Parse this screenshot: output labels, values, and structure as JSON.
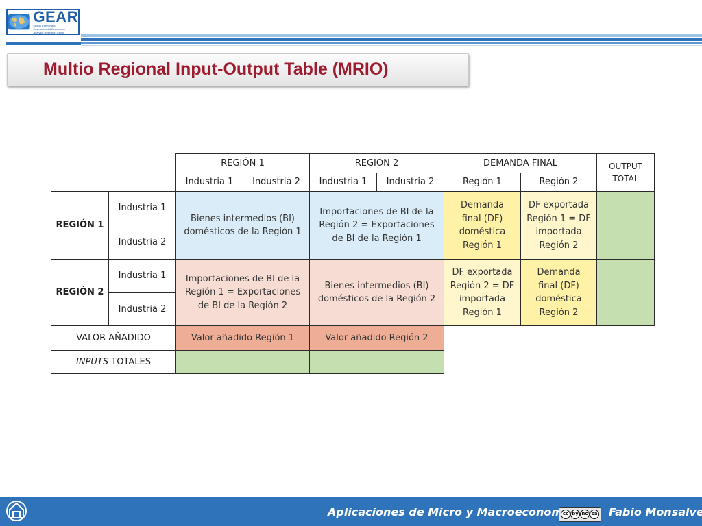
{
  "header": {
    "logo_word": "GEAR",
    "logo_tagline": "Global Energy and Environmental Economics Analysis Research Group",
    "title": "Multio Regional Input-Output Table (MRIO)"
  },
  "table": {
    "col_headers": {
      "region1": "REGIÓN 1",
      "region2": "REGIÓN 2",
      "final_demand": "DEMANDA FINAL",
      "output_total": "OUTPUT TOTAL",
      "r1_ind1": "Industria 1",
      "r1_ind2": "Industria 2",
      "r2_ind1": "Industria 1",
      "r2_ind2": "Industria 2",
      "fd_r1": "Región 1",
      "fd_r2": "Región 2"
    },
    "row_headers": {
      "region1": "REGIÓN 1",
      "region2": "REGIÓN 2",
      "r1_ind1": "Industria 1",
      "r1_ind2": "Industria 2",
      "r2_ind1": "Industria 1",
      "r2_ind2": "Industria 2",
      "value_added": "VALOR AÑADIDO",
      "inputs_prefix": "INPUTS",
      "inputs_suffix": " TOTALES"
    },
    "cells": {
      "bi_dom_r1": "Bienes intermedios (BI) domésticos de la Región 1",
      "imp_r2": "Importaciones de BI de la Región 2 = Exportaciones de BI de la Región 1",
      "fd_dom_r1": "Demanda final (DF) doméstica Región 1",
      "df_exp_r1": "DF exportada Región 1 = DF importada Región 2",
      "imp_r1": "Importaciones de BI de la Región 1 = Exportaciones de BI de la Región 2",
      "bi_dom_r2": "Bienes intermedios (BI) domésticos de la Región 2",
      "df_exp_r2": "DF exportada Región 2 = DF importada Región 1",
      "fd_dom_r2": "Demanda final (DF) doméstica Región 2",
      "va_r1": "Valor añadido Región 1",
      "va_r2": "Valor añadido Región 2"
    }
  },
  "footer": {
    "course": "Aplicaciones de Micro y Macroeconomía",
    "license": [
      "cc",
      "by",
      "nc",
      "sa"
    ],
    "author": "Fabio Monsalve"
  },
  "colors": {
    "title": "#9e1b2f",
    "footer_bar": "#2f73bb",
    "logo_blue": "#1f5fa8",
    "domestic_bi": "#d9ecf8",
    "imports_bi": "#f6dcd3",
    "domestic_fd": "#fff1a6",
    "exported_fd": "#fff6cc",
    "value_added": "#eeae96",
    "totals": "#c5dfb1"
  }
}
